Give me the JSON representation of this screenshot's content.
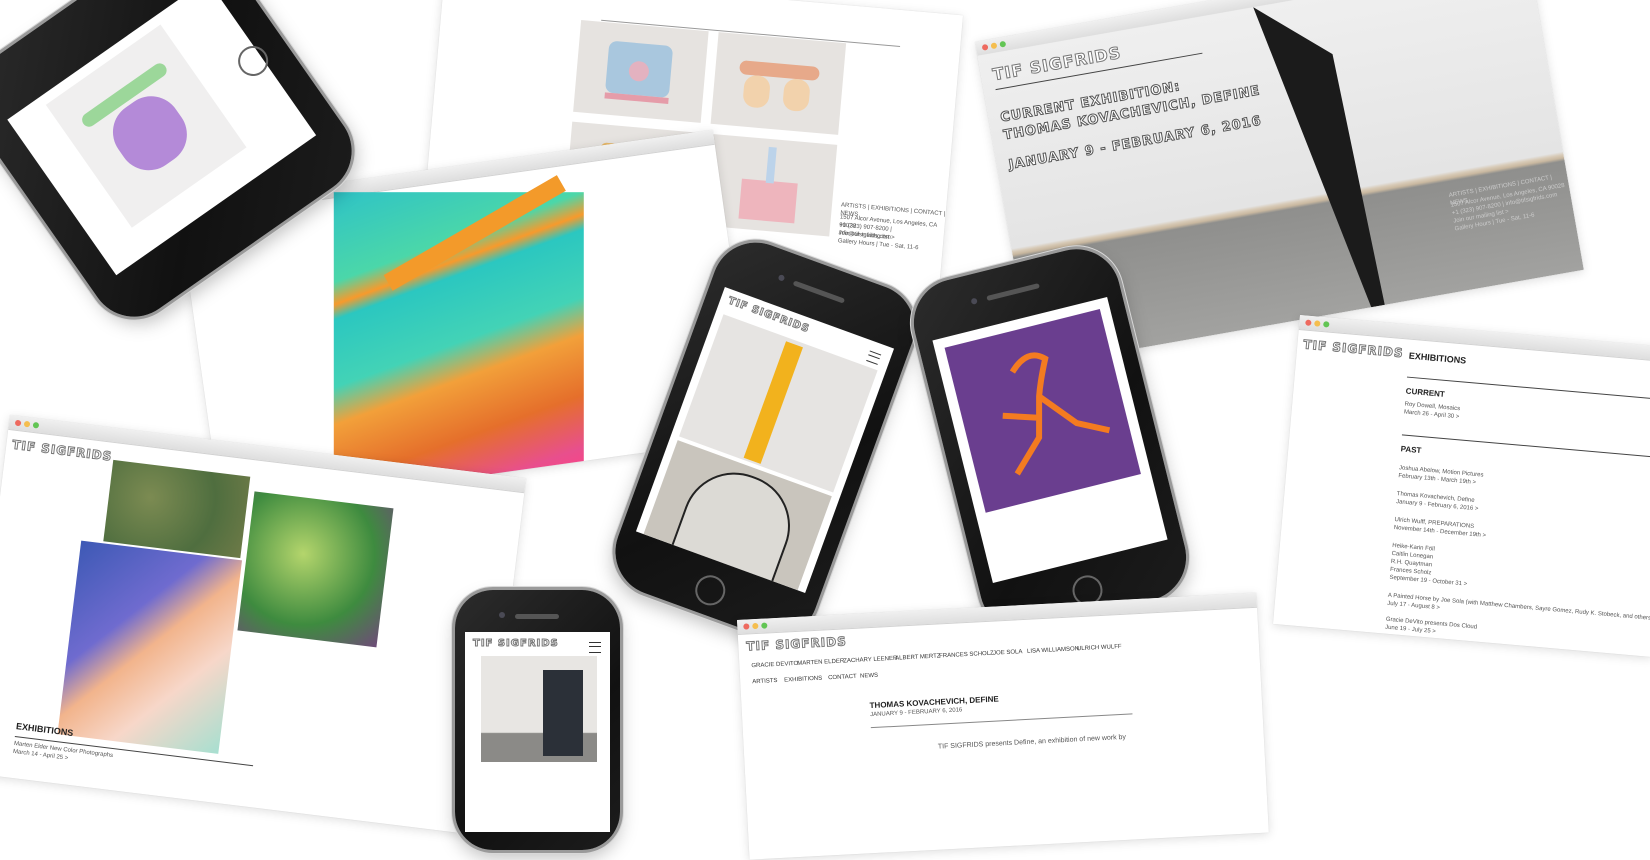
{
  "brand": {
    "logo": "TIF SIGFRIDS"
  },
  "hero_card": {
    "heading_line1": "CURRENT EXHIBITION:",
    "heading_line2": "THOMAS KOVACHEVICH, DEFINE",
    "dates": "JANUARY 9 - FEBRUARY 6, 2016",
    "footer_nav": "ARTISTS | EXHIBITIONS | CONTACT | NEWS",
    "footer_address": "1507 Alcor Avenue, Los Angeles, CA 90028",
    "footer_phone": "+1 (323) 907-8200 | info@tifsigfrids.com",
    "footer_mailing": "Join our mailing list >",
    "footer_hours": "Gallery Hours | Tue - Sat, 11-6"
  },
  "sculpture_card": {
    "footer_nav": "ARTISTS | EXHIBITIONS | CONTACT | NEWS",
    "footer_address": "1507 Alcor Avenue, Los Angeles, CA 90028",
    "footer_phone": "+1 (323) 907-8200 | info@tifsigfrids.com",
    "footer_mailing": "Join our mailing list >",
    "footer_hours": "Gallery Hours | Tue - Sat, 11-6"
  },
  "exhibitions_card": {
    "title": "EXHIBITIONS",
    "current_heading": "CURRENT",
    "current_item_name": "Roy Dowell, Mosaics",
    "current_item_dates": "March 26 - April 30 >",
    "past_heading": "PAST",
    "past_items": [
      {
        "name": "Joshua Abelow, Motion Pictures",
        "dates": "February 13th - March 19th >"
      },
      {
        "name": "Thomas Kovachevich, Define",
        "dates": "January 9 - February 6, 2016 >"
      },
      {
        "name": "Ulrich Wulff, PREPARATIONS",
        "dates": "November 14th - December 19th >"
      },
      {
        "name": "Heike-Karin Föll\nCaitlin Lonegan\nR.H. Quaytman\nFrances Scholz",
        "dates": "September 19 - October 31 >"
      },
      {
        "name": "A Painted Horse by Joe Sola (with Matthew Chambers, Sayre Gomez, Rudy K. Stobeck, and others)",
        "dates": "July 17 - August 8 >"
      },
      {
        "name": "Gracie DeVito presents Dos Cloud",
        "dates": "June 19 - July 25 >"
      }
    ]
  },
  "left_card": {
    "title": "EXHIBITIONS",
    "item_name": "Marten Elder New Color Photographs",
    "item_dates": "March 14 - April 25 >"
  },
  "bottom_card": {
    "artists": [
      "GRACIE DEVITO",
      "MARTEN ELDER",
      "ZACHARY LEENER",
      "ALBERT MERTZ",
      "FRANCES SCHOLZ",
      "JOE SOLA",
      "LISA WILLIAMSON",
      "ULRICH WULFF"
    ],
    "nav": [
      "ARTISTS",
      "EXHIBITIONS",
      "CONTACT",
      "NEWS"
    ],
    "title": "THOMAS KOVACHEVICH, DEFINE",
    "dates": "JANUARY 9 - FEBRUARY 6, 2016",
    "body": "TIF SIGFRIDS presents Define, an exhibition of new work by"
  },
  "colors": {
    "accent_orange": "#f47b20",
    "accent_yellow": "#f2b21d",
    "purple": "#6a3e8f"
  }
}
